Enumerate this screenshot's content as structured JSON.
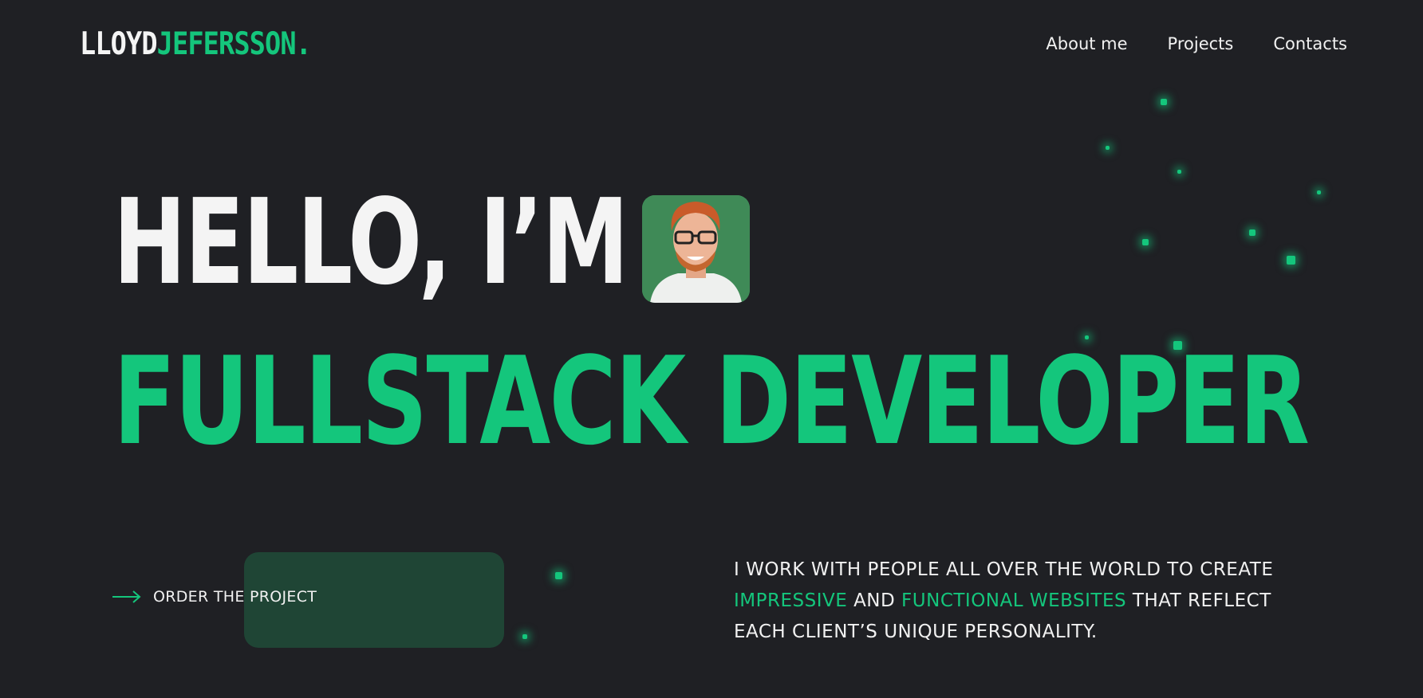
{
  "logo": {
    "first": "LLOYD",
    "last": "JEFERSSON."
  },
  "nav": [
    {
      "label": "About me"
    },
    {
      "label": "Projects"
    },
    {
      "label": "Contacts"
    }
  ],
  "hero": {
    "line1": "HELLO, I’M",
    "line2": "FULLSTACK DEVELOPER"
  },
  "cta": {
    "label": "ORDER THE PROJECT"
  },
  "tagline": {
    "part1": "I WORK WITH PEOPLE ALL OVER THE WORLD TO CREATE",
    "hl1": "IMPRESSIVE",
    "part2": "AND",
    "hl2": "FUNCTIONAL WEBSITES",
    "part3": "THAT REFLECT EACH CLIENT’S UNIQUE PERSONALITY."
  },
  "colors": {
    "background": "#1f2024",
    "accent": "#14c67c",
    "text": "#f1f1f1",
    "button_bg": "#1f4535"
  },
  "icons": {
    "arrow": "arrow-right-icon",
    "avatar": "profile-photo"
  }
}
